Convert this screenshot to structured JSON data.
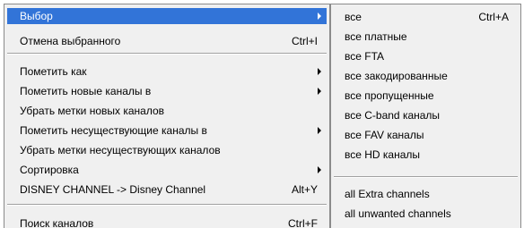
{
  "main_menu": {
    "items": [
      {
        "label": "Выбор",
        "shortcut": "",
        "submenu": true,
        "selected": true
      },
      {
        "label": "Отмена выбранного",
        "shortcut": "Ctrl+I",
        "submenu": false
      },
      {
        "label": "Пометить как",
        "shortcut": "",
        "submenu": true
      },
      {
        "label": "Пометить новые каналы в",
        "shortcut": "",
        "submenu": true
      },
      {
        "label": "Убрать метки новых каналов",
        "shortcut": "",
        "submenu": false
      },
      {
        "label": "Пометить несуществующие каналы в",
        "shortcut": "",
        "submenu": true
      },
      {
        "label": "Убрать метки несуществующих каналов",
        "shortcut": "",
        "submenu": false
      },
      {
        "label": "Сортировка",
        "shortcut": "",
        "submenu": true
      },
      {
        "label": "DISNEY CHANNEL -> Disney Channel",
        "shortcut": "Alt+Y",
        "submenu": false
      },
      {
        "label": "Поиск каналов",
        "shortcut": "Ctrl+F",
        "submenu": false
      }
    ]
  },
  "submenu": {
    "items": [
      {
        "label": "все",
        "shortcut": "Ctrl+A"
      },
      {
        "label": "все платные",
        "shortcut": ""
      },
      {
        "label": "все FTA",
        "shortcut": ""
      },
      {
        "label": "все закодированные",
        "shortcut": ""
      },
      {
        "label": "все пропущенные",
        "shortcut": ""
      },
      {
        "label": "все C-band каналы",
        "shortcut": ""
      },
      {
        "label": "все FAV каналы",
        "shortcut": ""
      },
      {
        "label": "все HD каналы",
        "shortcut": ""
      },
      {
        "label": "all Extra channels",
        "shortcut": ""
      },
      {
        "label": "all unwanted channels",
        "shortcut": ""
      }
    ]
  },
  "colors": {
    "menu_background": "#f0f0f0",
    "highlight": "#3274d8",
    "highlight_text": "#ffffff",
    "border": "#8a8a8a"
  },
  "icons": {
    "submenu_arrow": "chevron-right-icon"
  }
}
